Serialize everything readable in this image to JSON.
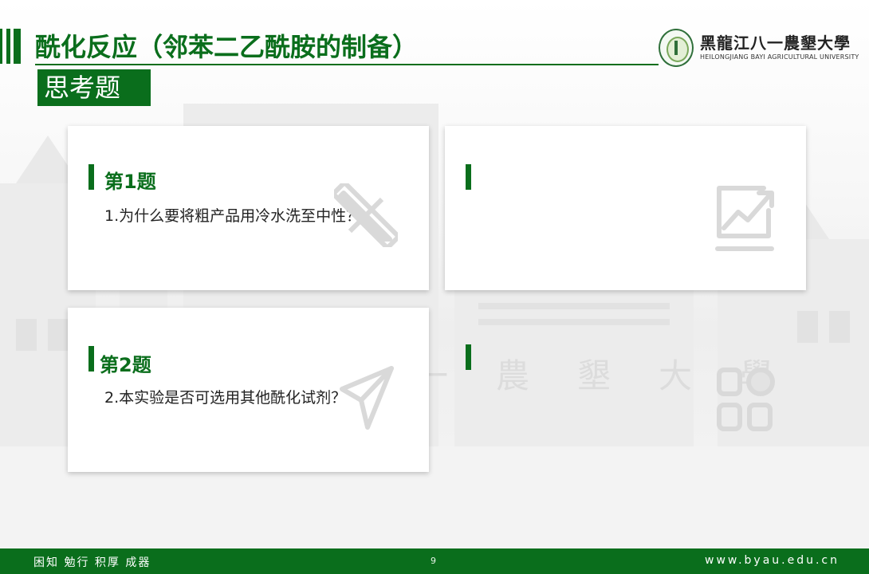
{
  "header": {
    "title": "酰化反应（邻苯二乙酰胺的制备）",
    "subtitle": "思考题"
  },
  "logo": {
    "name_cn": "黑龍江八一農墾大學",
    "name_en": "HEILONGJIANG BAYI AGRICULTURAL UNIVERSITY"
  },
  "cards": [
    {
      "title": "第1题",
      "text": "1.为什么要将粗产品用冷水洗至中性？",
      "icon": "pencil-ruler-icon"
    },
    {
      "title": "",
      "text": "",
      "icon": "chart-trend-icon"
    },
    {
      "title": "第2题",
      "text": "2.本实验是否可选用其他酰化试剂？",
      "icon": "paper-plane-icon"
    },
    {
      "title": "",
      "text": "",
      "icon": "grid-apps-icon"
    }
  ],
  "footer": {
    "motto": "困知 勉行 积厚 成器",
    "page": "9",
    "url": "www.byau.edu.cn"
  },
  "colors": {
    "brand_green": "#0a6e1c",
    "icon_gray": "#d9d9d9"
  }
}
